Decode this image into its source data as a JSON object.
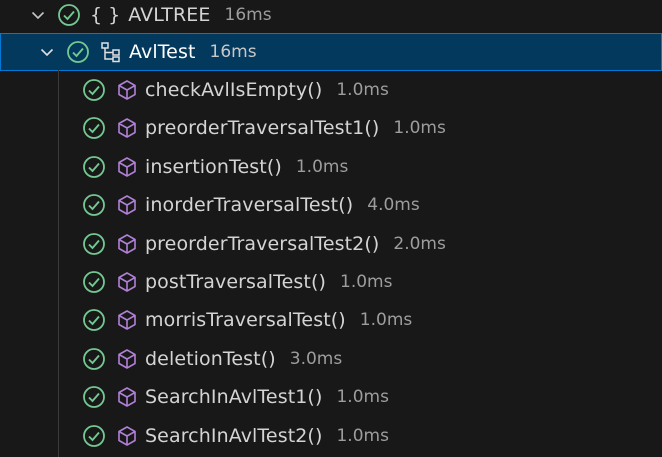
{
  "suite": {
    "icon": "braces-icon",
    "braces_text": "{ }",
    "label": "AVLTREE",
    "duration": "16ms",
    "status": "passed"
  },
  "class_node": {
    "icon": "test-class-icon",
    "label": "AvlTest",
    "duration": "16ms",
    "status": "passed",
    "selected": true
  },
  "tests": [
    {
      "label": "checkAvlIsEmpty()",
      "duration": "1.0ms",
      "icon": "method-cube-icon",
      "status": "passed"
    },
    {
      "label": "preorderTraversalTest1()",
      "duration": "1.0ms",
      "icon": "method-cube-icon",
      "status": "passed"
    },
    {
      "label": "insertionTest()",
      "duration": "1.0ms",
      "icon": "method-cube-icon",
      "status": "passed"
    },
    {
      "label": "inorderTraversalTest()",
      "duration": "4.0ms",
      "icon": "method-cube-icon",
      "status": "passed"
    },
    {
      "label": "preorderTraversalTest2()",
      "duration": "2.0ms",
      "icon": "method-cube-icon",
      "status": "passed"
    },
    {
      "label": "postTraversalTest()",
      "duration": "1.0ms",
      "icon": "method-cube-icon",
      "status": "passed"
    },
    {
      "label": "morrisTraversalTest()",
      "duration": "1.0ms",
      "icon": "method-cube-icon",
      "status": "passed"
    },
    {
      "label": "deletionTest()",
      "duration": "3.0ms",
      "icon": "method-cube-icon",
      "status": "passed"
    },
    {
      "label": "SearchInAvlTest1()",
      "duration": "1.0ms",
      "icon": "method-cube-icon",
      "status": "passed"
    },
    {
      "label": "SearchInAvlTest2()",
      "duration": "1.0ms",
      "icon": "method-cube-icon",
      "status": "passed"
    }
  ],
  "colors": {
    "background": "#181818",
    "selection_bg": "#04395e",
    "selection_border": "#0078d4",
    "passed_green": "#73c991",
    "method_purple": "#b180d7",
    "text": "#d4d4d4",
    "duration_text": "#9d9d9d"
  }
}
